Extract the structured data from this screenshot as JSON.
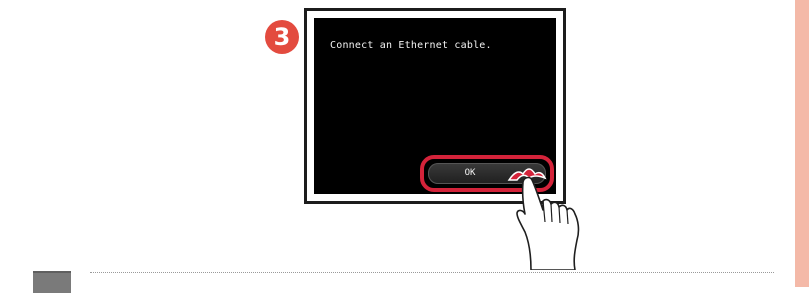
{
  "step": {
    "number": "3"
  },
  "screen": {
    "message": "Connect an Ethernet cable.",
    "ok_label": "OK"
  },
  "colors": {
    "step_badge": "#e34b3f",
    "highlight": "#d4233a",
    "screen_bg": "#000000",
    "side_strip": "#f4b9a8"
  },
  "icons": {
    "hand": "pointing-hand-icon",
    "tap": "tap-indicator-icon",
    "note": "note-icon"
  }
}
